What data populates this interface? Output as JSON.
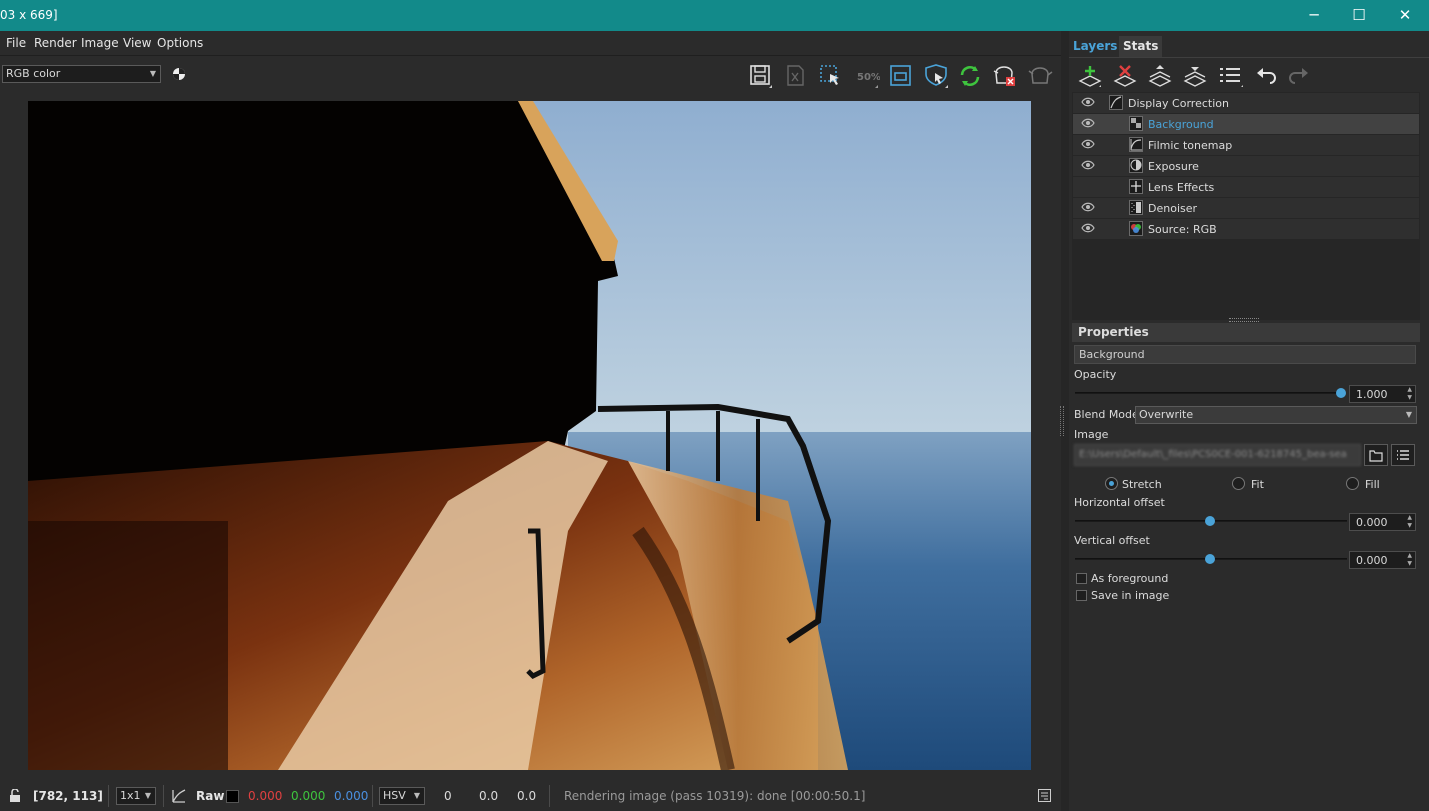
{
  "window": {
    "title": "03 x 669]",
    "minimize": "─",
    "maximize": "☐",
    "close": "✕"
  },
  "menu": [
    "File",
    "Render",
    "Image",
    "View",
    "Options"
  ],
  "toolbar": {
    "color_mode": "RGB color",
    "icons": [
      "save-icon",
      "export-icon",
      "region-select-icon",
      "zoom-50-icon",
      "fit-view-icon",
      "shield-pick-icon",
      "refresh-icon",
      "clear-cache-icon",
      "teapot-icon"
    ],
    "zoom_label": "50%"
  },
  "status": {
    "coords": "[782, 113]",
    "scale": "1x1",
    "raw_label": "Raw",
    "r": "0.000",
    "g": "0.000",
    "b": "0.000",
    "colorspace": "HSV",
    "h": "0",
    "s": "0.0",
    "v": "0.0",
    "message": "Rendering image (pass 10319): done [00:00:50.1]"
  },
  "panel": {
    "tabs": [
      "Layers",
      "Stats"
    ],
    "layers": [
      {
        "name": "Display Correction",
        "visible": true,
        "selected": false,
        "indent": 0,
        "icon": "curve-icon"
      },
      {
        "name": "Background",
        "visible": true,
        "selected": true,
        "indent": 1,
        "icon": "checker-icon"
      },
      {
        "name": "Filmic tonemap",
        "visible": true,
        "selected": false,
        "indent": 1,
        "icon": "tonemap-icon"
      },
      {
        "name": "Exposure",
        "visible": true,
        "selected": false,
        "indent": 1,
        "icon": "exposure-icon"
      },
      {
        "name": "Lens Effects",
        "visible": false,
        "selected": false,
        "indent": 1,
        "icon": "lens-icon"
      },
      {
        "name": "Denoiser",
        "visible": true,
        "selected": false,
        "indent": 1,
        "icon": "denoiser-icon"
      },
      {
        "name": "Source: RGB",
        "visible": true,
        "selected": false,
        "indent": 1,
        "icon": "rgb-source-icon"
      }
    ],
    "properties": {
      "header": "Properties",
      "layer_name": "Background",
      "opacity_label": "Opacity",
      "opacity_value": "1.000",
      "opacity_level": 1.0,
      "blend_label": "Blend Mode",
      "blend_value": "Overwrite",
      "image_label": "Image",
      "image_path": "E:\\Users\\Default\\_files\\PCS0CE-001-6218745_bea-sea",
      "fit_options": [
        "Stretch",
        "Fit",
        "Fill"
      ],
      "fit_selected": "Stretch",
      "h_offset_label": "Horizontal offset",
      "h_offset_value": "0.000",
      "v_offset_label": "Vertical offset",
      "v_offset_value": "0.000",
      "as_foreground": "As foreground",
      "save_in_image": "Save in image"
    }
  },
  "colors": {
    "titlebar": "#128a8a",
    "accent": "#4aa3d8",
    "red": "#e04040",
    "green": "#3ec43e",
    "blue": "#4a8fe0"
  }
}
